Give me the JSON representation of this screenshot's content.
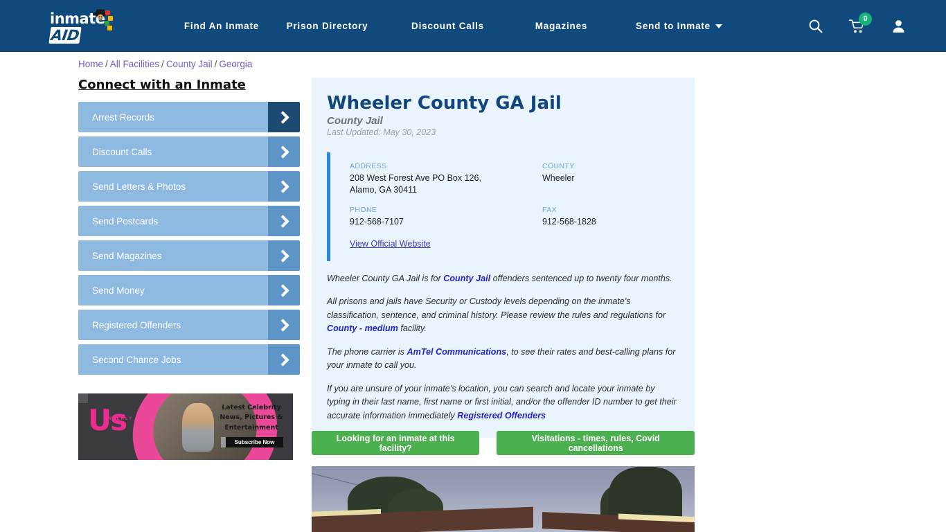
{
  "header": {
    "logo_text": "inmate",
    "logo_accent": "AID",
    "logo_name": "inmateAID",
    "nav": [
      {
        "label": "Find An Inmate",
        "has_caret": false
      },
      {
        "label": "Prison Directory",
        "has_caret": false
      },
      {
        "label": "Discount Calls",
        "has_caret": false
      },
      {
        "label": "Magazines",
        "has_caret": false
      },
      {
        "label": "Send to Inmate",
        "has_caret": true
      }
    ],
    "icons": {
      "search": "search-icon",
      "cart": "cart-icon",
      "cart_count": "0",
      "account": "user-account-icon"
    },
    "bar_color": "#104a7c",
    "badge_color": "#18b37a"
  },
  "breadcrumb": {
    "items": [
      "Home",
      "All Facilities",
      "County Jail",
      "Georgia"
    ],
    "separator": "/",
    "link_color": "#6b5ecb"
  },
  "sidebar": {
    "title": "Connect with an Inmate",
    "items": [
      {
        "label": "Arrest Records",
        "hover": true
      },
      {
        "label": "Discount Calls",
        "hover": false
      },
      {
        "label": "Send Letters & Photos",
        "hover": false
      },
      {
        "label": "Send Postcards",
        "hover": false
      },
      {
        "label": "Send Magazines",
        "hover": false
      },
      {
        "label": "Send Money",
        "hover": false
      },
      {
        "label": "Registered Offenders",
        "hover": false
      },
      {
        "label": "Second Chance Jobs",
        "hover": false
      }
    ],
    "button_color": "#8ebae2",
    "arrow_color": "#5e95c9",
    "arrow_hover_color": "#1d4a73"
  },
  "ad": {
    "brand": "Us",
    "brand_sub": "WEEKLY",
    "copy": "Latest Celebrity News, Pictures & Entertainment",
    "cta": "Subscribe Now",
    "accent_color": "#ec2c8f"
  },
  "facility": {
    "title": "Wheeler County GA Jail",
    "subtitle": "County Jail",
    "last_updated": "Last Updated: May 30, 2023",
    "info": {
      "address_label": "ADDRESS",
      "address_value": "208 West Forest Ave PO Box 126, Alamo, GA 30411",
      "county_label": "COUNTY",
      "county_value": "Wheeler",
      "phone_label": "PHONE",
      "phone_value": "912-568-7107",
      "fax_label": "FAX",
      "fax_value": "912-568-1828",
      "website_link": "View Official Website"
    },
    "description": [
      {
        "parts": [
          {
            "text": "Wheeler County GA Jail is for ",
            "link": false
          },
          {
            "text": "County Jail",
            "link": true
          },
          {
            "text": " offenders sentenced up to twenty four months.",
            "link": false
          }
        ]
      },
      {
        "parts": [
          {
            "text": "All prisons and jails have Security or Custody levels depending on the inmate's classification, sentence, and criminal history. Please review the rules and regulations for ",
            "link": false
          },
          {
            "text": "County - medium",
            "link": true
          },
          {
            "text": " facility.",
            "link": false
          }
        ]
      },
      {
        "parts": [
          {
            "text": "The phone carrier is ",
            "link": false
          },
          {
            "text": "AmTel Communications",
            "link": true
          },
          {
            "text": ", to see their rates and best-calling plans for your inmate to call you.",
            "link": false
          }
        ]
      },
      {
        "parts": [
          {
            "text": "If you are unsure of your inmate's location, you can search and locate your inmate by typing in their last name, first name or first initial, and/or the offender ID number to get their accurate information immediately ",
            "link": false
          },
          {
            "text": "Registered Offenders",
            "link": true
          }
        ]
      }
    ],
    "panel_color": "#eaf4fd",
    "accent_bar_color": "#2389e0",
    "title_color": "#11457e"
  },
  "cta_buttons": [
    {
      "label": "Looking for an inmate at this facility?"
    },
    {
      "label": "Visitations - times, rules, Covid cancellations"
    }
  ],
  "cta_color": "#4caf50",
  "facility_photo": {
    "alt": "facility-exterior-photo"
  }
}
